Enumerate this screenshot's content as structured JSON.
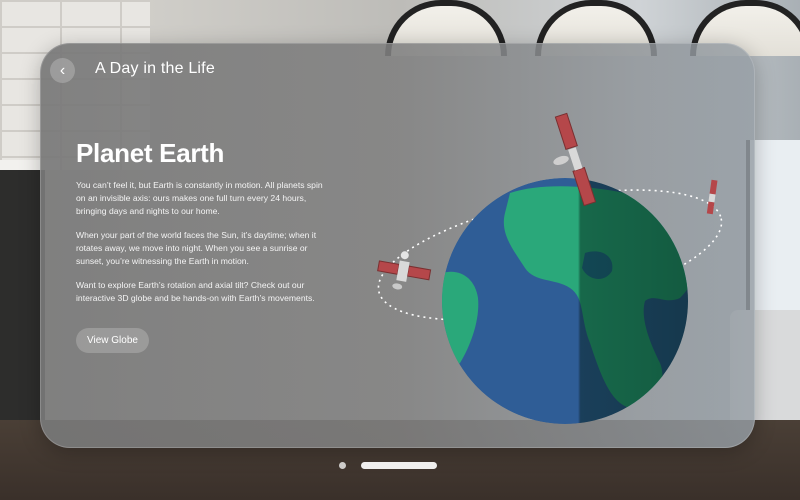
{
  "header": {
    "back_icon": "chevron-left-icon",
    "title": "A Day in the Life"
  },
  "article": {
    "heading": "Planet Earth",
    "paragraphs": [
      "You can’t feel it, but Earth is constantly in motion. All planets spin on an invisible axis: ours makes one full turn every 24 hours, bringing days and nights to our home.",
      "When your part of the world faces the Sun, it’s daytime; when it rotates away, we move into night. When you see a sunrise or sunset, you’re witnessing the Earth in motion.",
      "Want to explore Earth’s rotation and axial tilt? Check out our interactive 3D globe and be hands-on with Earth’s movements."
    ],
    "button_label": "View Globe"
  },
  "illustration": {
    "subject": "earth-globe-with-orbiting-satellites",
    "colors": {
      "ocean": "#2f5d96",
      "land": "#2aa87a",
      "night_shadow": "#0f2a1f"
    }
  },
  "page_indicator": {
    "pages": 2,
    "current": 2
  }
}
